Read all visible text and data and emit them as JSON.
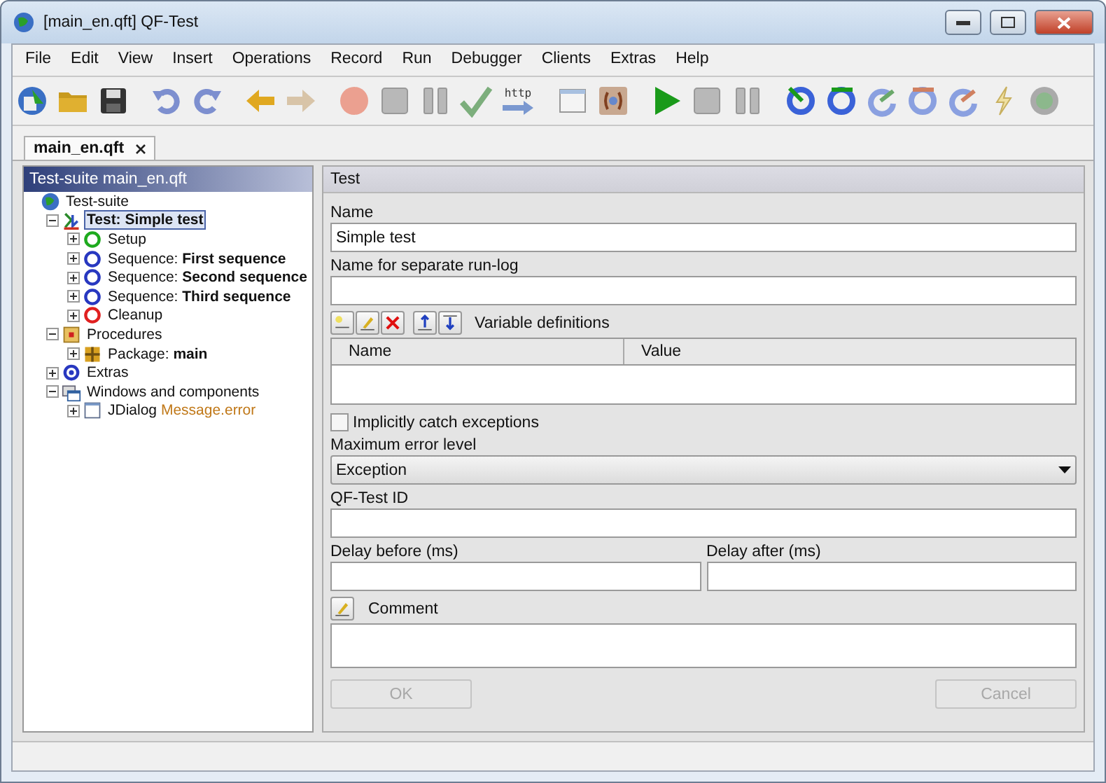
{
  "window": {
    "title": "[main_en.qft] QF-Test"
  },
  "menu": [
    "File",
    "Edit",
    "View",
    "Insert",
    "Operations",
    "Record",
    "Run",
    "Debugger",
    "Clients",
    "Extras",
    "Help"
  ],
  "toolbar": [
    [
      {
        "kind": "suite"
      },
      {
        "kind": "open"
      },
      {
        "kind": "save"
      }
    ],
    [
      {
        "kind": "undo"
      },
      {
        "kind": "redo"
      }
    ],
    [
      {
        "kind": "back"
      },
      {
        "kind": "forward"
      }
    ],
    [
      {
        "kind": "record"
      },
      {
        "kind": "square"
      },
      {
        "kind": "pause"
      },
      {
        "kind": "check"
      },
      {
        "kind": "http",
        "label": "http"
      }
    ],
    [
      {
        "kind": "dialog"
      },
      {
        "kind": "braces"
      }
    ],
    [
      {
        "kind": "play"
      },
      {
        "kind": "square"
      },
      {
        "kind": "pause"
      }
    ],
    [
      {
        "kind": "step-in"
      },
      {
        "kind": "step-over"
      },
      {
        "kind": "step-out"
      },
      {
        "kind": "skip-over"
      },
      {
        "kind": "skip-out"
      },
      {
        "kind": "lightning"
      },
      {
        "kind": "breakpoint"
      }
    ]
  ],
  "tabs": [
    {
      "label": "main_en.qft",
      "selected": true
    }
  ],
  "tree": {
    "title": "Test-suite main_en.qft",
    "items": [
      {
        "kind": "suite",
        "label": "Test-suite",
        "selected": false,
        "children": [
          {
            "kind": "test",
            "label": "**Test: Simple test**",
            "selected": true,
            "expanded": true,
            "children": [
              {
                "kind": "setup",
                "label": "Setup",
                "selected": false,
                "expanded": false
              },
              {
                "kind": "sequence",
                "label": "Sequence: **First sequence**",
                "selected": false,
                "expanded": false
              },
              {
                "kind": "sequence",
                "label": "Sequence: **Second sequence**",
                "selected": false,
                "expanded": false
              },
              {
                "kind": "sequence",
                "label": "Sequence: **Third sequence**",
                "selected": false,
                "expanded": false
              },
              {
                "kind": "cleanup",
                "label": "Cleanup",
                "selected": false,
                "expanded": false
              }
            ]
          },
          {
            "kind": "procedures",
            "label": "Procedures",
            "selected": false,
            "expanded": true,
            "children": [
              {
                "kind": "package",
                "label": "Package: **main**",
                "selected": false,
                "expanded": false
              }
            ]
          },
          {
            "kind": "extras",
            "label": "Extras",
            "selected": false,
            "expanded": false
          },
          {
            "kind": "windows",
            "label": "Windows and components",
            "selected": false,
            "expanded": true,
            "children": [
              {
                "kind": "dialog",
                "label": "JDialog",
                "detail": "Message.error",
                "selected": false,
                "expanded": false
              }
            ]
          }
        ]
      }
    ]
  },
  "editor": {
    "title": "Test",
    "name": {
      "label": "Name",
      "value": "Simple test"
    },
    "runlog": {
      "label": "Name for separate run-log"
    },
    "variables": {
      "label": "Variable definitions",
      "columns": [
        "Name",
        "Value"
      ]
    },
    "catch": {
      "label": "Implicitly catch exceptions",
      "checked": false
    },
    "error_level": {
      "label": "Maximum error level",
      "value": "Exception"
    },
    "qftest_id": {
      "label": "QF-Test ID"
    },
    "delay_before": {
      "label": "Delay before (ms)"
    },
    "delay_after": {
      "label": "Delay after (ms)"
    },
    "comment": {
      "label": "Comment"
    },
    "buttons": [
      {
        "label": "OK",
        "disabled": true
      },
      {
        "label": "Cancel",
        "disabled": true
      }
    ]
  }
}
